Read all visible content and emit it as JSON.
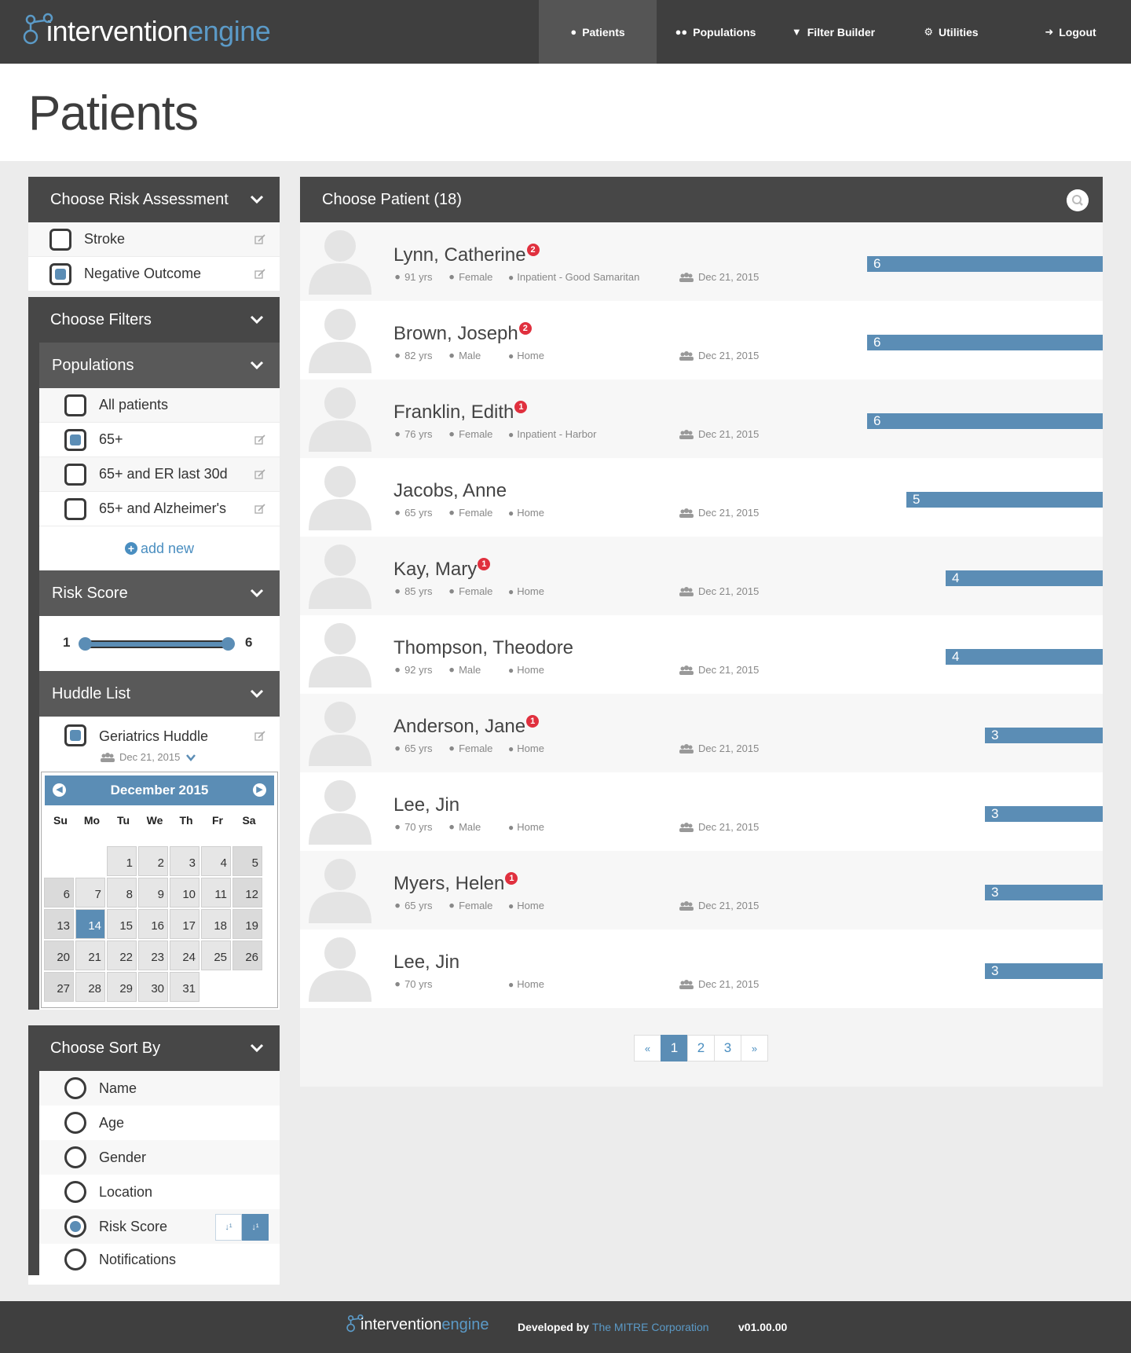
{
  "app": {
    "logo_text_a": "intervention",
    "logo_text_b": "engine"
  },
  "nav": {
    "items": [
      {
        "label": "Patients",
        "icon": "user-icon",
        "active": true
      },
      {
        "label": "Populations",
        "icon": "users-icon"
      },
      {
        "label": "Filter Builder",
        "icon": "filter-icon"
      },
      {
        "label": "Utilities",
        "icon": "cogs-icon"
      },
      {
        "label": "Logout",
        "icon": "sign-out-icon"
      }
    ]
  },
  "page_title": "Patients",
  "sidebar": {
    "risk_assessment": {
      "title": "Choose Risk Assessment",
      "items": [
        {
          "label": "Stroke",
          "checked": false
        },
        {
          "label": "Negative Outcome",
          "checked": true
        }
      ]
    },
    "filters": {
      "title": "Choose Filters",
      "populations": {
        "title": "Populations",
        "items": [
          {
            "label": "All patients",
            "checked": false
          },
          {
            "label": "65+",
            "checked": true
          },
          {
            "label": "65+ and ER last 30d",
            "checked": false
          },
          {
            "label": "65+ and Alzheimer's",
            "checked": false
          }
        ],
        "add_new": "add new"
      },
      "risk_score": {
        "title": "Risk Score",
        "min": "1",
        "max": "6"
      },
      "huddle": {
        "title": "Huddle List",
        "item_label": "Geriatrics Huddle",
        "checked": true,
        "date": "Dec 21, 2015",
        "calendar": {
          "month": "December 2015",
          "dow": [
            "Su",
            "Mo",
            "Tu",
            "We",
            "Th",
            "Fr",
            "Sa"
          ],
          "selected_day": "14"
        }
      }
    },
    "sort": {
      "title": "Choose Sort By",
      "items": [
        {
          "label": "Name",
          "selected": false
        },
        {
          "label": "Age",
          "selected": false
        },
        {
          "label": "Gender",
          "selected": false
        },
        {
          "label": "Location",
          "selected": false
        },
        {
          "label": "Risk Score",
          "selected": true
        },
        {
          "label": "Notifications",
          "selected": false
        }
      ]
    }
  },
  "patients": {
    "title": "Choose Patient (18)",
    "rows": [
      {
        "name": "Lynn, Catherine",
        "notif": "2",
        "age": "91 yrs",
        "gender": "Female",
        "location": "Inpatient - Good Samaritan",
        "date": "Dec 21, 2015",
        "risk": "6"
      },
      {
        "name": "Brown, Joseph",
        "notif": "2",
        "age": "82 yrs",
        "gender": "Male",
        "location": "Home",
        "date": "Dec 21, 2015",
        "risk": "6"
      },
      {
        "name": "Franklin, Edith",
        "notif": "1",
        "age": "76 yrs",
        "gender": "Female",
        "location": "Inpatient - Harbor",
        "date": "Dec 21, 2015",
        "risk": "6"
      },
      {
        "name": "Jacobs, Anne",
        "notif": "",
        "age": "65 yrs",
        "gender": "Female",
        "location": "Home",
        "date": "Dec 21, 2015",
        "risk": "5"
      },
      {
        "name": "Kay, Mary",
        "notif": "1",
        "age": "85 yrs",
        "gender": "Female",
        "location": "Home",
        "date": "Dec 21, 2015",
        "risk": "4"
      },
      {
        "name": "Thompson, Theodore",
        "notif": "",
        "age": "92 yrs",
        "gender": "Male",
        "location": "Home",
        "date": "Dec 21, 2015",
        "risk": "4"
      },
      {
        "name": "Anderson, Jane",
        "notif": "1",
        "age": "65 yrs",
        "gender": "Female",
        "location": "Home",
        "date": "Dec 21, 2015",
        "risk": "3"
      },
      {
        "name": "Lee, Jin",
        "notif": "",
        "age": "70 yrs",
        "gender": "Male",
        "location": "Home",
        "date": "Dec 21, 2015",
        "risk": "3"
      },
      {
        "name": "Myers, Helen",
        "notif": "1",
        "age": "65 yrs",
        "gender": "Female",
        "location": "Home",
        "date": "Dec 21, 2015",
        "risk": "3"
      },
      {
        "name": "Lee, Jin",
        "notif": "",
        "age": "70 yrs",
        "gender": "",
        "location": "Home",
        "date": "Dec 21, 2015",
        "risk": "3"
      }
    ],
    "risk_max": 6,
    "pager": [
      "«",
      "1",
      "2",
      "3",
      "»"
    ],
    "pager_active": "1"
  },
  "footer": {
    "logo_text_a": "intervention",
    "logo_text_b": "engine",
    "developed_by": "Developed by",
    "org": "The MITRE Corporation",
    "version": "v01.00.00"
  },
  "colors": {
    "accent": "#5b8db5",
    "nav_bg": "#3f3f3f",
    "notif": "#e0303e"
  }
}
